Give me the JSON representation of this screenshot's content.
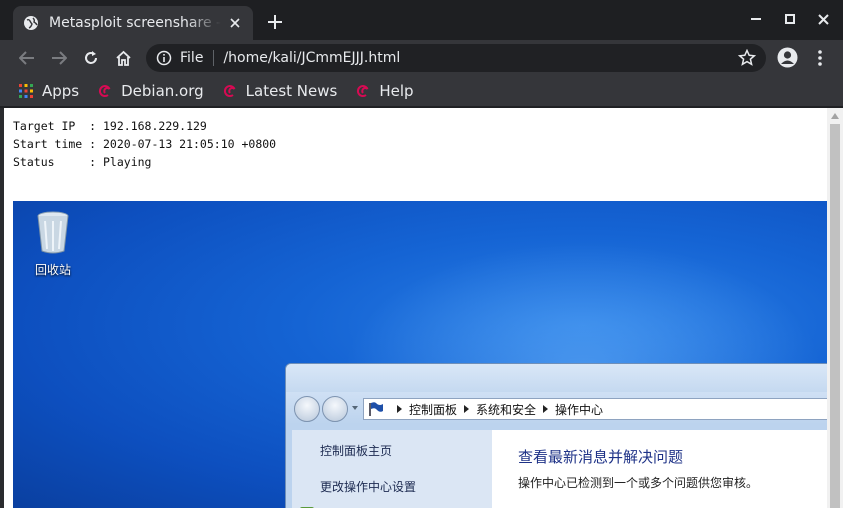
{
  "browser": {
    "tab_title": "Metasploit screenshare - Mozilla",
    "omnibox": {
      "scheme": "File",
      "url": "/home/kali/JCmmEJJJ.html"
    },
    "bookmarks": [
      {
        "label": "Apps",
        "icon": "apps-grid-icon"
      },
      {
        "label": "Debian.org",
        "icon": "debian-swirl-icon"
      },
      {
        "label": "Latest News",
        "icon": "debian-swirl-icon"
      },
      {
        "label": "Help",
        "icon": "debian-swirl-icon"
      }
    ]
  },
  "page": {
    "target_ip_line": "Target IP  : 192.168.229.129",
    "start_time_line": "Start time : 2020-07-13 21:05:10 +0800",
    "status_line": "Status     : Playing"
  },
  "remote_desktop": {
    "recycle_bin_label": "回收站",
    "control_panel": {
      "breadcrumb": [
        "控制面板",
        "系统和安全",
        "操作中心"
      ],
      "side_links": [
        "控制面板主页",
        "更改操作中心设置"
      ],
      "main_title": "查看最新消息并解决问题",
      "main_subtitle": "操作中心已检测到一个或多个问题供您审核。"
    }
  },
  "colors": {
    "chrome_bg": "#35363a",
    "titlebar_bg": "#1e1f22",
    "desktop_blue": "#1564d4",
    "debian_red": "#d70a53"
  }
}
